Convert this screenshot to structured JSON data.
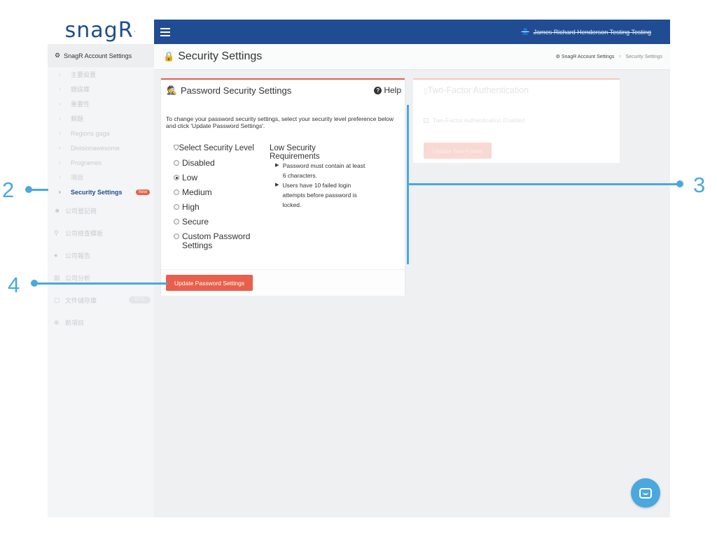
{
  "logo": {
    "text": "snag",
    "r": "R",
    "dot": "·"
  },
  "sidebar": {
    "header": "SnagR Account Settings",
    "sub_items": [
      {
        "label": "主要設置"
      },
      {
        "label": "錯誤庫"
      },
      {
        "label": "重要性"
      },
      {
        "label": "類題"
      },
      {
        "label": "Regions gaga"
      },
      {
        "label": "Divisionawesome"
      },
      {
        "label": "Programes"
      },
      {
        "label": "項目"
      }
    ],
    "active_item": {
      "label": "Security Settings",
      "badge": "New"
    },
    "main_items": [
      {
        "label": "公司登記冊"
      },
      {
        "label": "公司檢查模板"
      },
      {
        "label": "公司報告"
      },
      {
        "label": "公司分析"
      },
      {
        "label": "文件儲存庫",
        "pill": "BETA"
      },
      {
        "label": "新項目"
      }
    ]
  },
  "topbar": {
    "user_name": "James Richard Henderson Testing Testing"
  },
  "page": {
    "title": "Security Settings",
    "breadcrumb": {
      "root": "SnagR Account Settings",
      "separator": ">",
      "current": "Security Settings"
    }
  },
  "password_card": {
    "title": "Password Security Settings",
    "help_label": "Help",
    "intro": "To change your password security settings, select your security level preference below and click 'Update Password Settings'.",
    "level_title": "Select Security Level",
    "levels": [
      {
        "label": "Disabled",
        "checked": false
      },
      {
        "label": "Low",
        "checked": true
      },
      {
        "label": "Medium",
        "checked": false
      },
      {
        "label": "High",
        "checked": false
      },
      {
        "label": "Secure",
        "checked": false
      },
      {
        "label": "Custom Password Settings",
        "checked": false
      }
    ],
    "requirements_title": "Low Security Requirements",
    "requirements": [
      "Password must contain at least 6 characters.",
      "Users have 10 failed login attempts before password is locked."
    ],
    "update_button": "Update Password Settings"
  },
  "two_factor_card": {
    "title": "Two-Factor Authentication",
    "checkbox_label": "Two-Factor Authentication Enabled",
    "button": "Update Two-Factor"
  },
  "annotations": {
    "a2": "2",
    "a3": "3",
    "a4": "4"
  },
  "colors": {
    "accent": "#e8604c",
    "topbar": "#1f4c93",
    "annotation": "#4aa8de",
    "brand": "#1f4e8c"
  }
}
